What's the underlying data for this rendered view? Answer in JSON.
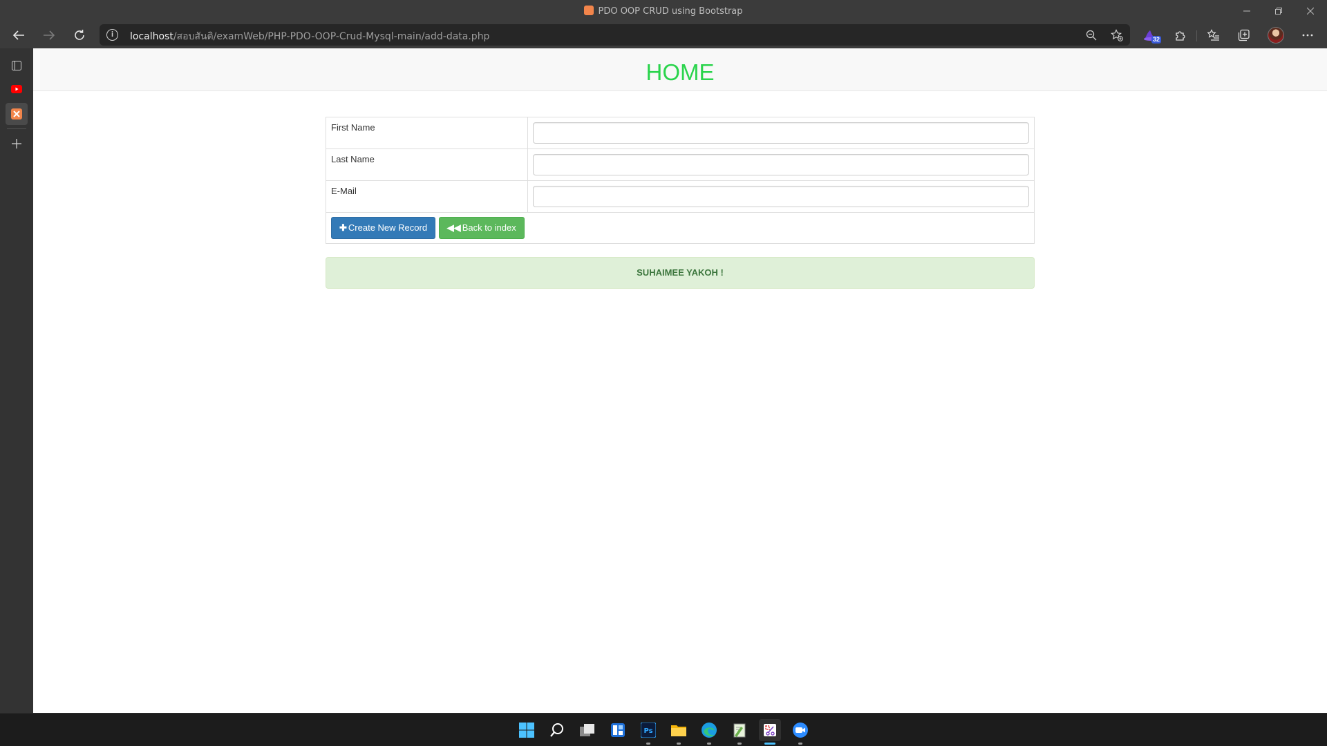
{
  "window": {
    "title": "PDO OOP CRUD using Bootstrap",
    "minimize_icon": "minimize-icon",
    "restore_icon": "restore-icon",
    "close_icon": "close-icon"
  },
  "address_bar": {
    "url_host": "localhost",
    "url_path": "/สอบสันติ/examWeb/PHP-PDO-OOP-Crud-Mysql-main/add-data.php"
  },
  "toolbar": {
    "extension_badge": "32"
  },
  "page": {
    "brand": "HOME",
    "brand_color": "#2ad44c",
    "form": {
      "fields": [
        {
          "label": "First Name",
          "value": ""
        },
        {
          "label": "Last Name",
          "value": ""
        },
        {
          "label": "E-Mail",
          "value": ""
        }
      ],
      "create_button": "Create New Record",
      "back_button": "Back to index"
    },
    "alert_text": "SUHAIMEE YAKOH !"
  },
  "colors": {
    "primary": "#337ab7",
    "success": "#5cb85c",
    "alert_bg": "#dff0d8",
    "alert_text": "#3c763d"
  }
}
